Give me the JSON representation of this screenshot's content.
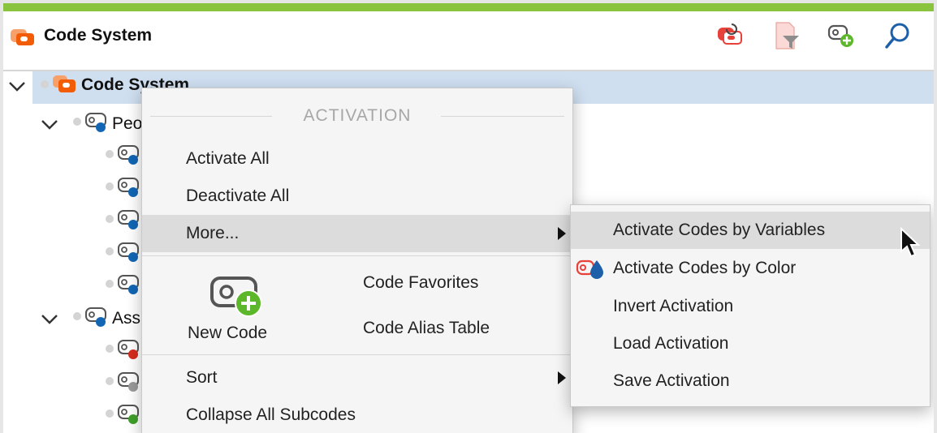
{
  "header": {
    "title": "Code System",
    "tools": [
      "activate-codes-icon",
      "filter-icon",
      "new-code-icon",
      "search-icon"
    ]
  },
  "tree": {
    "root_label": "Code System",
    "nodes": [
      {
        "label": "Peo",
        "color": "#1266b4"
      },
      {
        "label": "",
        "color": "#1266b4"
      },
      {
        "label": "",
        "color": "#1266b4"
      },
      {
        "label": "",
        "color": "#1266b4"
      },
      {
        "label": "",
        "color": "#1266b4"
      },
      {
        "label": "",
        "color": "#1266b4"
      },
      {
        "label": "Ass",
        "color": "#1266b4"
      },
      {
        "label": "",
        "color": "#d62b1f"
      },
      {
        "label": "",
        "color": "#9a9a9a"
      },
      {
        "label": "",
        "color": "#3fa02a"
      }
    ]
  },
  "context_menu": {
    "section_title": "ACTIVATION",
    "activate_all": "Activate All",
    "deactivate_all": "Deactivate All",
    "more": "More...",
    "new_code": "New Code",
    "code_favorites": "Code Favorites",
    "code_alias_table": "Code Alias Table",
    "sort": "Sort",
    "collapse_all": "Collapse All Subcodes"
  },
  "submenu": {
    "items": [
      "Activate Codes by Variables",
      "Activate Codes by Color",
      "Invert Activation",
      "Load Activation",
      "Save Activation"
    ]
  },
  "colors": {
    "accent_green": "#8ac43f",
    "code_orange": "#f25c05",
    "selection": "#cfdff0"
  }
}
